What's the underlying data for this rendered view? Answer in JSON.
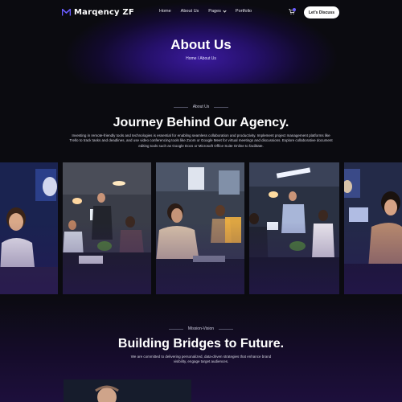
{
  "brand": {
    "name": "Marqency ZF",
    "accent": "#6a5cff"
  },
  "nav": {
    "items": [
      "Home",
      "About Us",
      "Pages",
      "Portfolio"
    ],
    "cta_label": "Let's Discuss"
  },
  "hero": {
    "title": "About Us",
    "breadcrumb": "Home / About Us"
  },
  "about": {
    "eyebrow": "About Us",
    "heading": "Journey Behind Our Agency.",
    "paragraph": "Investing in remote-friendly tools and technologies is essential for enabling seamless collaboration and productivity. Implement project management platforms like Trello to track tasks and deadlines, and use video conferencing tools like Zoom or Google Meet for virtual meetings and discussions. Explore collaborative document editing tools such as Google Docs or Microsoft Office Suite Online to facilitate."
  },
  "gallery": {
    "photos": [
      "team-photo-1",
      "team-photo-2",
      "team-photo-3",
      "team-photo-4",
      "team-photo-5"
    ]
  },
  "mission": {
    "eyebrow": "Mission-Vision",
    "heading": "Building Bridges to Future.",
    "paragraph": "We are committed to delivering personalized, data-driven strategies that enhance brand visibility, engage target audiences."
  }
}
